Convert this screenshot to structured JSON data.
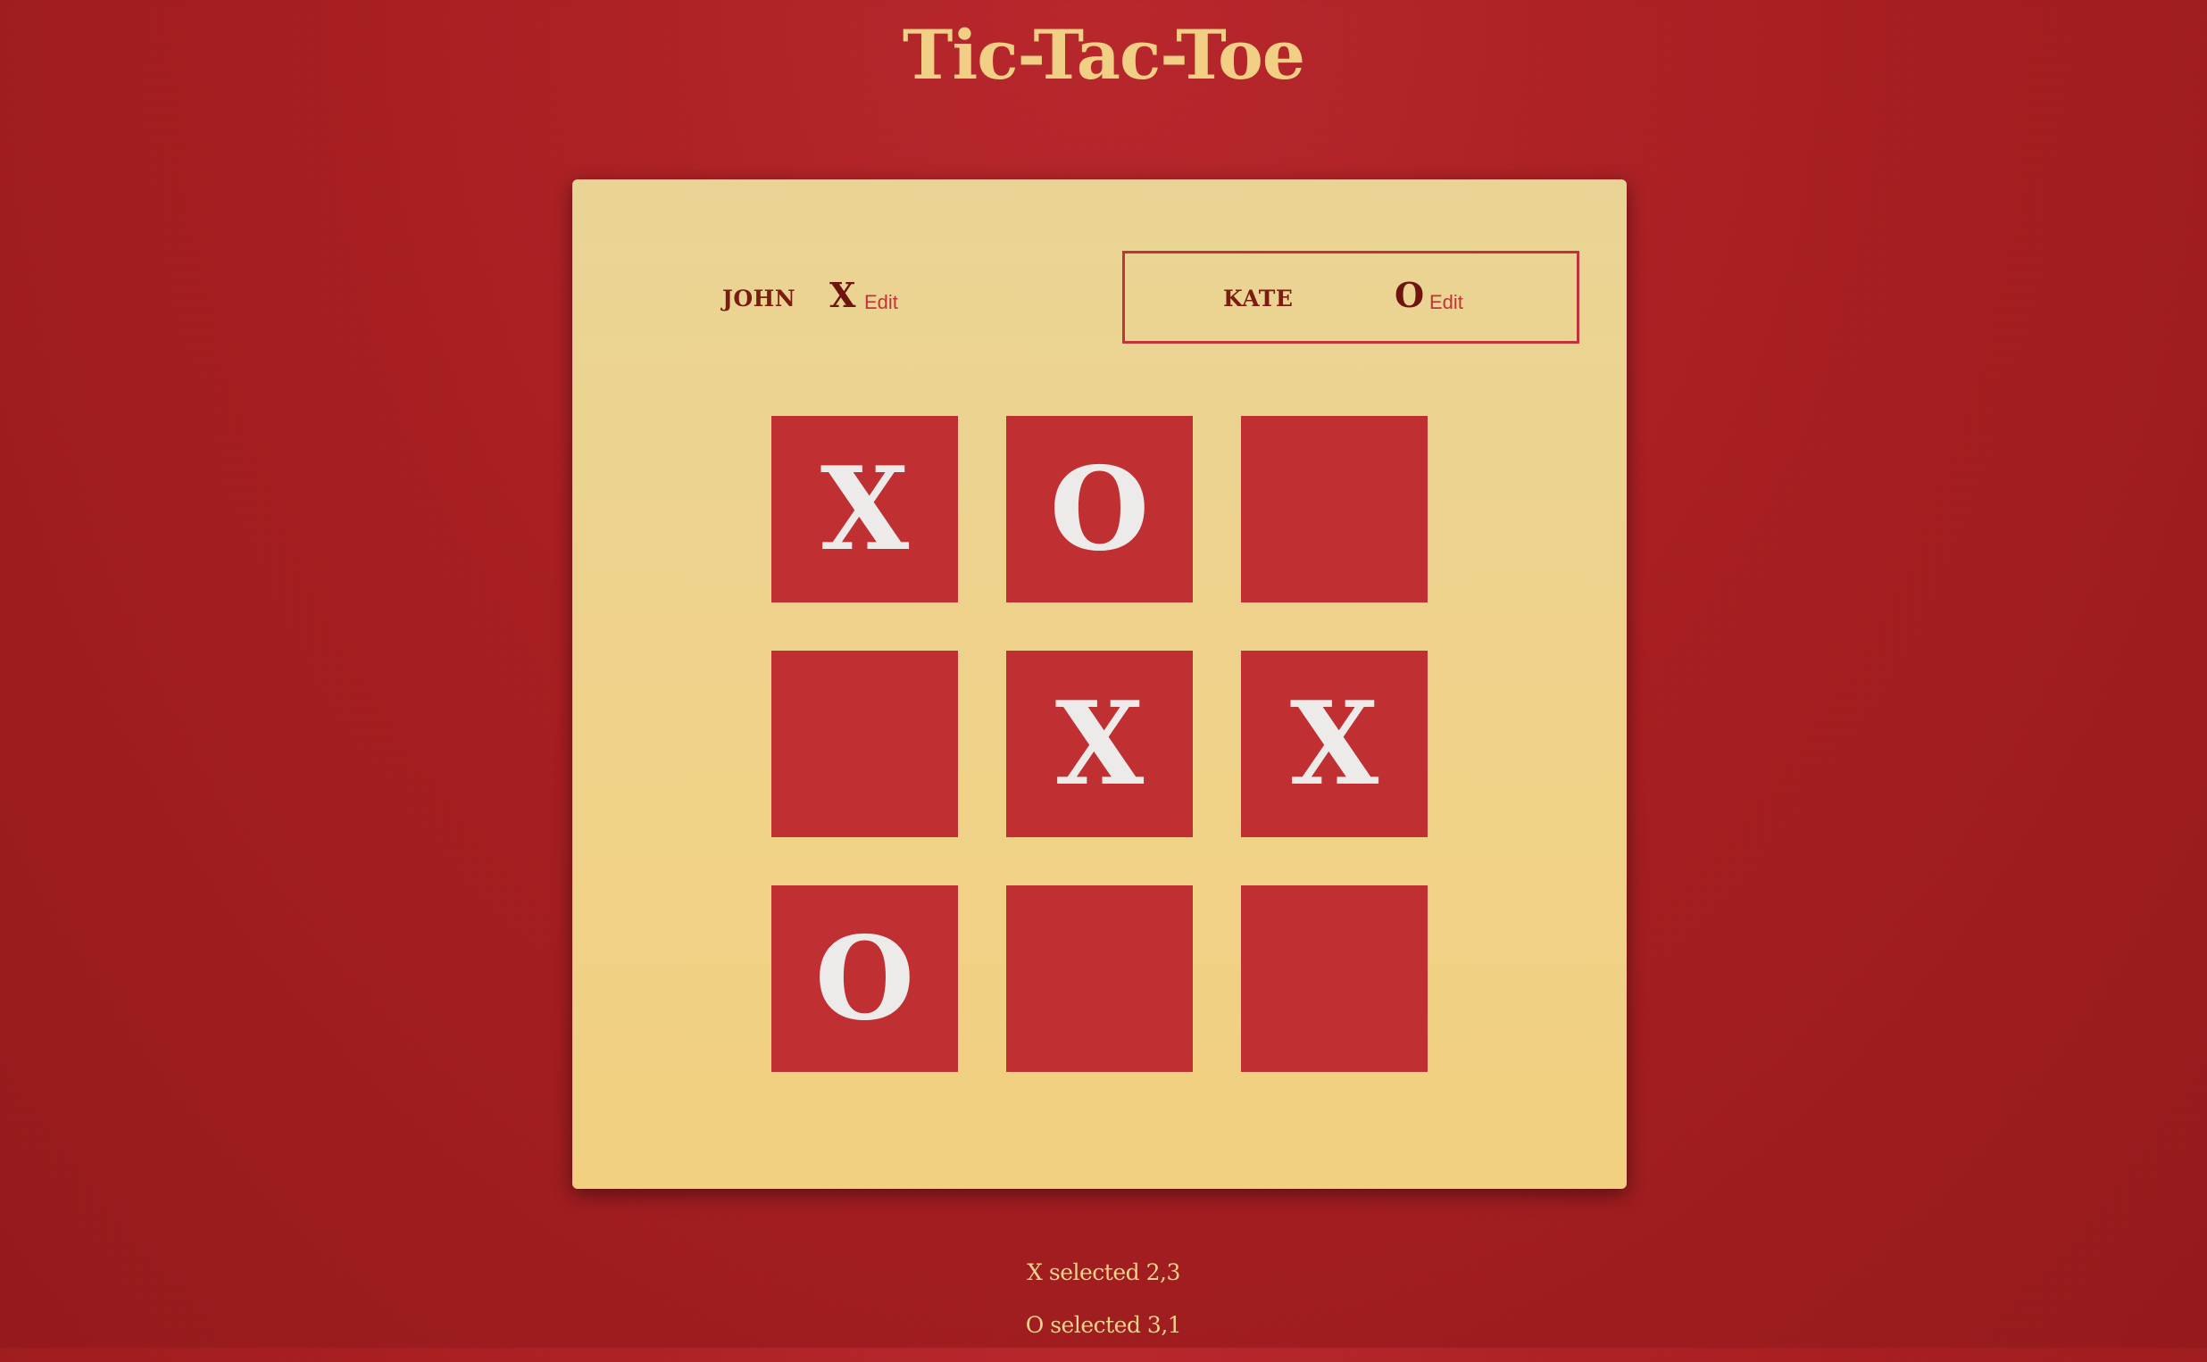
{
  "title": "Tic-Tac-Toe",
  "players": [
    {
      "name": "JOHN",
      "symbol": "X",
      "edit_label": "Edit",
      "active": false
    },
    {
      "name": "KATE",
      "symbol": "O",
      "edit_label": "Edit",
      "active": true
    }
  ],
  "board": [
    [
      "X",
      "O",
      ""
    ],
    [
      "",
      "X",
      "X"
    ],
    [
      "O",
      "",
      ""
    ]
  ],
  "log": [
    "X selected 2,3",
    "O selected 3,1"
  ],
  "colors": {
    "background": "#a91f22",
    "title": "#f1cf85",
    "panel": "#eed28a",
    "cell": "#c03032",
    "mark": "#ecebe9",
    "active_border": "#c0353a",
    "player_text": "#7a1c12",
    "edit_link": "#c0353a"
  }
}
